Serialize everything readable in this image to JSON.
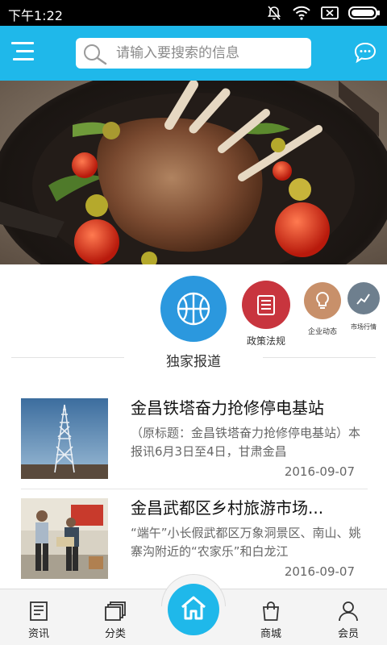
{
  "status_bar": {
    "time": "下午1:22",
    "icons": [
      "mute-icon",
      "wifi-icon",
      "no-sim-icon",
      "battery-icon"
    ]
  },
  "header": {
    "menu_icon": "menu-icon",
    "search_placeholder": "请输入要搜索的信息",
    "message_icon": "message-icon",
    "color": "#1fb8ea"
  },
  "banner": {
    "slide_count": 2,
    "active_slide": 1
  },
  "categories": [
    {
      "label": "独家报道",
      "icon": "basketball-icon",
      "color": "#2b98de",
      "selected": true
    },
    {
      "label": "政策法规",
      "icon": "document-icon",
      "color": "#c8353e",
      "selected": false
    },
    {
      "label": "企业动态",
      "icon": "lightbulb-icon",
      "color": "#c8906a",
      "selected": false
    },
    {
      "label": "市场行情",
      "icon": "market-icon",
      "color": "#6e7f8e",
      "selected": false
    }
  ],
  "news": [
    {
      "title": "金昌铁塔奋力抢修停电基站",
      "summary": "（原标题：金昌铁塔奋力抢修停电基站）本报讯6月3日至4日，甘肃金昌",
      "date": "2016-09-07"
    },
    {
      "title": "金昌武都区乡村旅游市场...",
      "summary": "“端午”小长假武都区万象洞景区、南山、姚寨沟附近的“农家乐”和白龙江",
      "date": "2016-09-07"
    }
  ],
  "tabbar": {
    "tabs": [
      {
        "label": "资讯",
        "icon": "news-icon"
      },
      {
        "label": "分类",
        "icon": "category-icon"
      },
      {
        "label": "",
        "icon": "home-icon"
      },
      {
        "label": "商城",
        "icon": "shopping-bag-icon"
      },
      {
        "label": "会员",
        "icon": "user-icon"
      }
    ],
    "active_color": "#1fb8ea"
  }
}
